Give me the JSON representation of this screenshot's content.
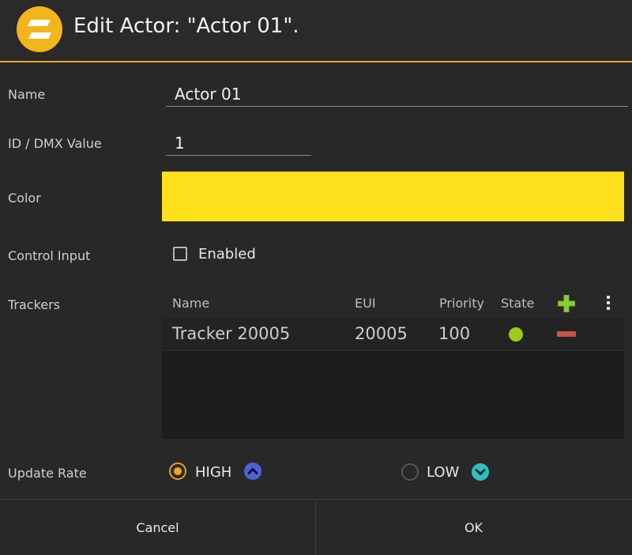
{
  "dialog": {
    "title": "Edit Actor: \"Actor 01\".",
    "logo_icon": "app-logo-icon",
    "accent_color": "#e8a418"
  },
  "form": {
    "name": {
      "label": "Name",
      "value": "Actor 01"
    },
    "id": {
      "label": "ID / DMX Value",
      "value": "1"
    },
    "color": {
      "label": "Color",
      "value": "#fde01c"
    },
    "control_input": {
      "label": "Control Input",
      "checkbox_label": "Enabled",
      "checked": false
    },
    "trackers": {
      "label": "Trackers",
      "columns": [
        "Name",
        "EUI",
        "Priority",
        "State"
      ],
      "add_icon": "plus-icon",
      "menu_icon": "kebab-menu-icon",
      "rows": [
        {
          "name": "Tracker 20005",
          "eui": "20005",
          "priority": "100",
          "state_color": "#9ccb1b",
          "remove_icon": "minus-icon"
        }
      ]
    },
    "update_rate": {
      "label": "Update Rate",
      "options": [
        {
          "label": "HIGH",
          "selected": true,
          "icon": "chevron-up-circle-icon",
          "icon_color": "#4a63d6"
        },
        {
          "label": "LOW",
          "selected": false,
          "icon": "chevron-down-circle-icon",
          "icon_color": "#2cc0c6"
        }
      ]
    }
  },
  "footer": {
    "cancel_label": "Cancel",
    "ok_label": "OK"
  }
}
